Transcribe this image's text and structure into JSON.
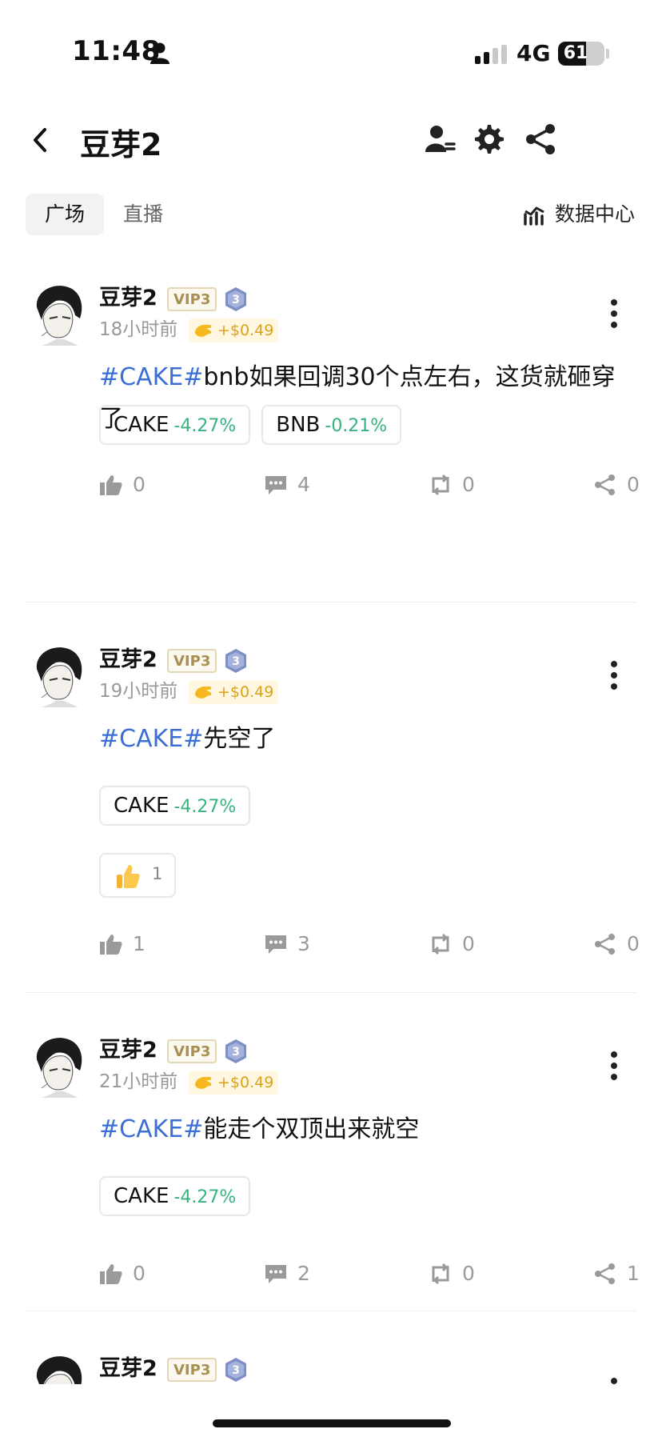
{
  "status_bar": {
    "time": "11:48",
    "network": "4G",
    "battery": "61",
    "battery_level": 0.61
  },
  "header": {
    "title": "豆芽2"
  },
  "tabs": [
    {
      "label": "广场",
      "active": true
    },
    {
      "label": "直播",
      "active": false
    }
  ],
  "data_center_label": "数据中心",
  "posts": [
    {
      "username": "豆芽2",
      "vip": "VIP3",
      "level": "3",
      "time": "18小时前",
      "tip": "+$0.49",
      "hashtag": "#CAKE#",
      "text": "bnb如果回调30个点左右，这货就砸穿了",
      "coins": [
        {
          "symbol": "CAKE",
          "change": "-4.27%"
        },
        {
          "symbol": "BNB",
          "change": "-0.21%"
        }
      ],
      "likes": "0",
      "comments": "4",
      "reposts": "0",
      "shares": "0"
    },
    {
      "username": "豆芽2",
      "vip": "VIP3",
      "level": "3",
      "time": "19小时前",
      "tip": "+$0.49",
      "hashtag": "#CAKE#",
      "text": "先空了",
      "coins": [
        {
          "symbol": "CAKE",
          "change": "-4.27%"
        }
      ],
      "reaction_count": "1",
      "likes": "1",
      "comments": "3",
      "reposts": "0",
      "shares": "0"
    },
    {
      "username": "豆芽2",
      "vip": "VIP3",
      "level": "3",
      "time": "21小时前",
      "tip": "+$0.49",
      "hashtag": "#CAKE#",
      "text": "能走个双顶出来就空",
      "coins": [
        {
          "symbol": "CAKE",
          "change": "-4.27%"
        }
      ],
      "likes": "0",
      "comments": "2",
      "reposts": "0",
      "shares": "1"
    },
    {
      "username": "豆芽2",
      "vip": "VIP3",
      "level": "3"
    }
  ],
  "colors": {
    "hashtag": "#3b6fd6",
    "negative_green": "#35b37e",
    "vip_gold": "#a88f52",
    "tip_orange": "#d9a21b"
  }
}
